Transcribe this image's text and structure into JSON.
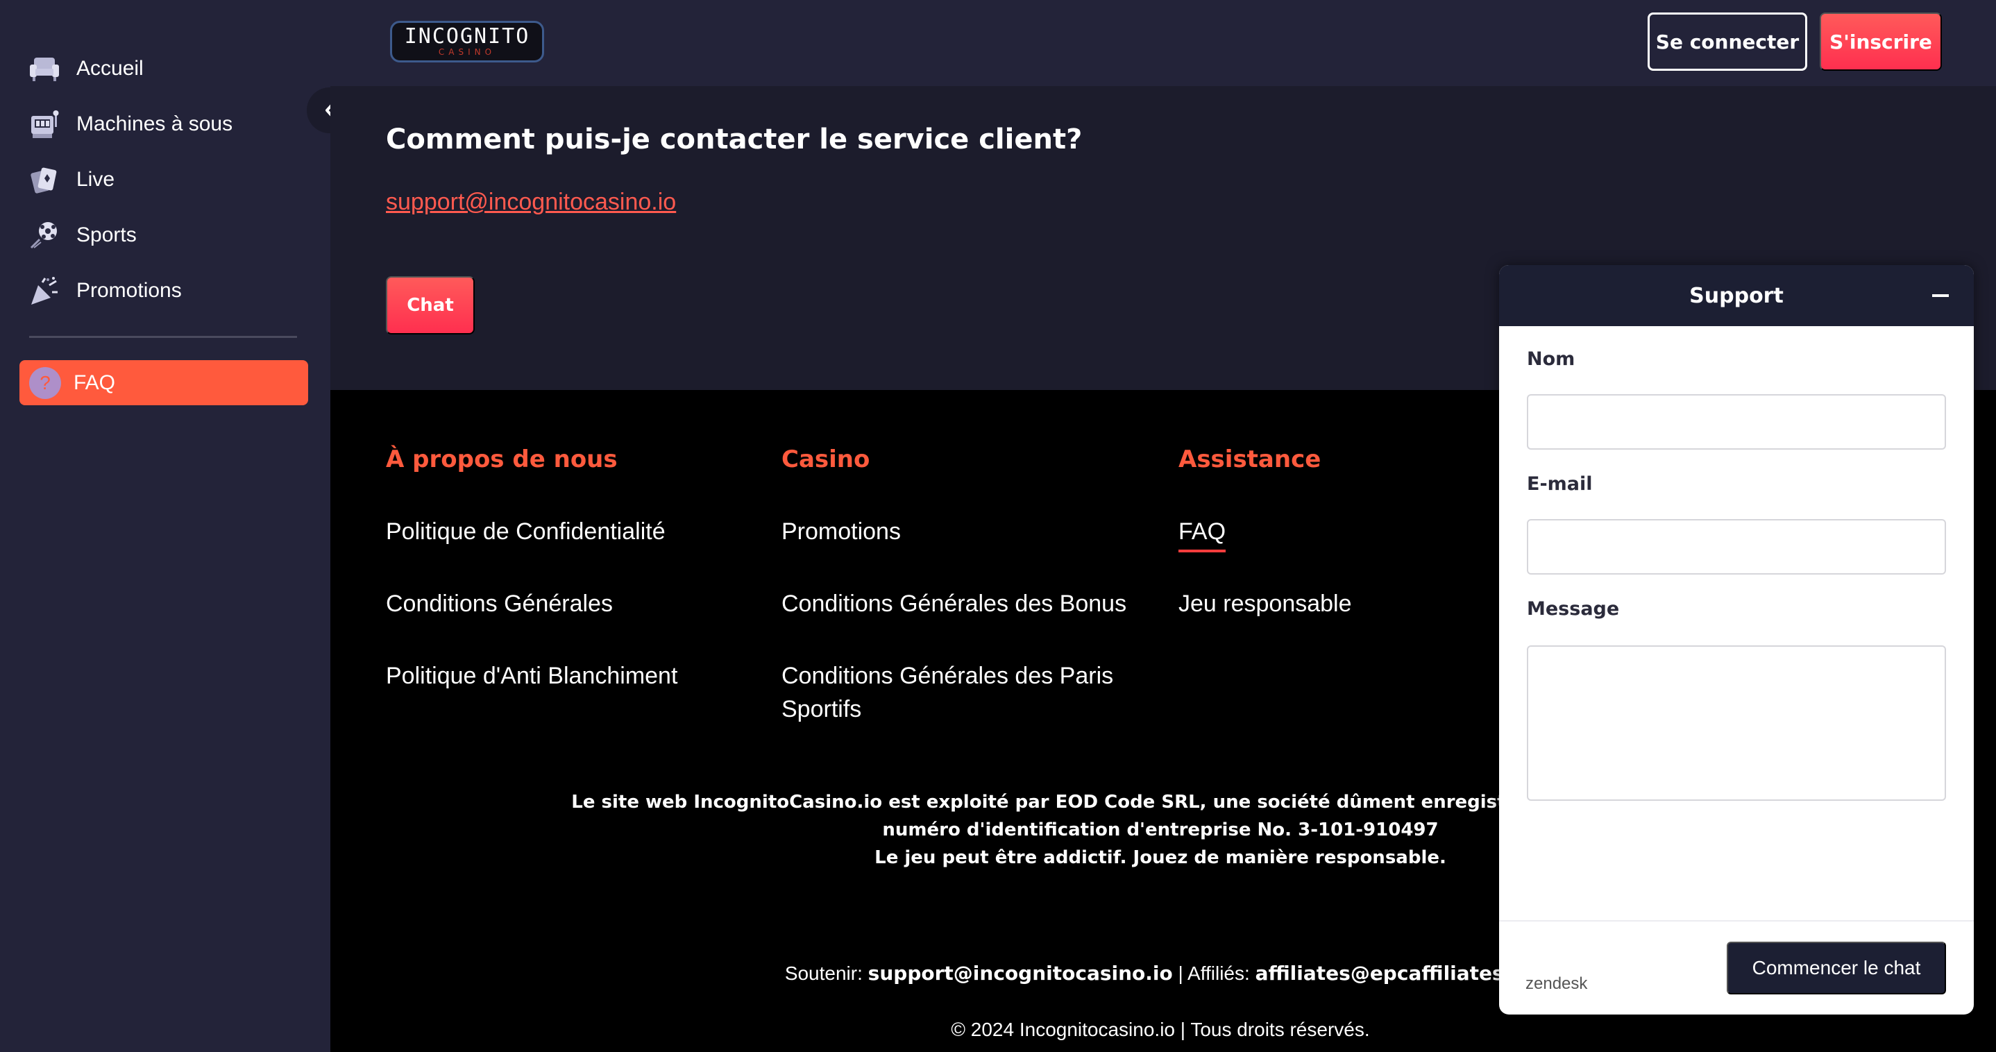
{
  "sidebar": {
    "items": [
      {
        "label": "Accueil",
        "icon": "sofa-icon"
      },
      {
        "label": "Machines à sous",
        "icon": "slot-machine-icon"
      },
      {
        "label": "Live",
        "icon": "cards-icon"
      },
      {
        "label": "Sports",
        "icon": "sports-ball-icon"
      },
      {
        "label": "Promotions",
        "icon": "party-popper-icon"
      }
    ],
    "faq": {
      "label": "FAQ",
      "icon": "question-icon"
    }
  },
  "header": {
    "logo_main": "INCOGNITO",
    "logo_sub": "CASINO",
    "login_label": "Se connecter",
    "signup_label": "S'inscrire"
  },
  "faq": {
    "question": "Comment puis-je contacter le service client?",
    "email": "support@incognitocasino.io",
    "chat_label": "Chat"
  },
  "footer": {
    "columns": [
      {
        "heading": "À propos de nous",
        "links": [
          "Politique de Confidentialité",
          "Conditions Générales",
          "Politique d'Anti Blanchiment"
        ]
      },
      {
        "heading": "Casino",
        "links": [
          "Promotions",
          "Conditions Générales des Bonus",
          "Conditions Générales des Paris Sportifs"
        ]
      },
      {
        "heading": "Assistance",
        "links": [
          "FAQ",
          "Jeu responsable"
        ]
      }
    ],
    "legal_line1": "Le site web IncognitoCasino.io est exploité par EOD Code SRL, une société dûment enregistrée conformément aux l",
    "legal_line2": "numéro d'identification d'entreprise No. 3-101-910497",
    "legal_line3": "Le jeu peut être addictif. Jouez de manière responsable.",
    "contact_prefix": "Soutenir: ",
    "contact_support": "support@incognitocasino.io",
    "contact_mid": " | Affiliés: ",
    "contact_affiliates": "affiliates@epcaffiliates.co",
    "copyright": "© 2024 Incognitocasino.io | Tous droits réservés."
  },
  "support": {
    "title": "Support",
    "name_label": "Nom",
    "email_label": "E-mail",
    "message_label": "Message",
    "name_value": "",
    "email_value": "",
    "message_value": "",
    "brand": "zendesk",
    "start_label": "Commencer le chat"
  },
  "colors": {
    "accent": "#ff5a3d",
    "sidebar_bg": "#232339",
    "content_bg": "#1c1c2c",
    "footer_bg": "#000000",
    "widget_dark": "#1c1f33"
  }
}
